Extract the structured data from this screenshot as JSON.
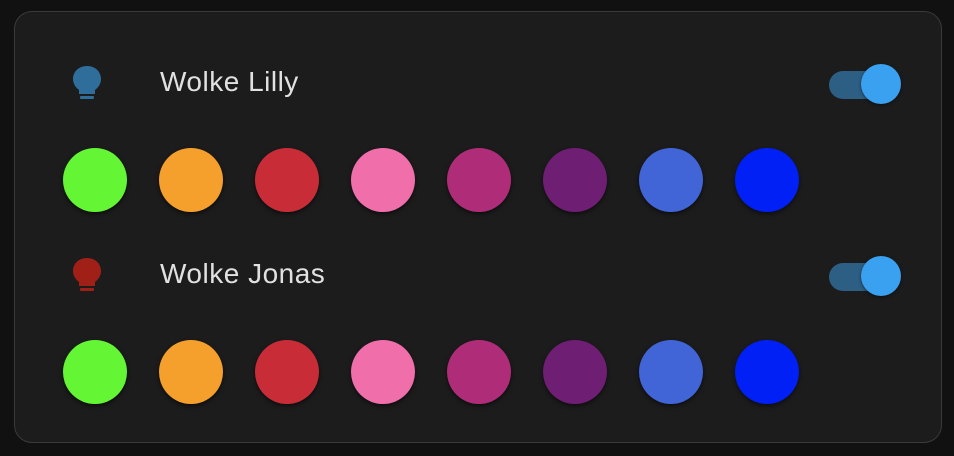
{
  "lights": [
    {
      "name": "Wolke Lilly",
      "icon": "lightbulb-icon",
      "icon_color": "#2f6e9a",
      "state": "on",
      "toggle_track_color": "#2d5f85",
      "toggle_knob_color": "#3aa0f0"
    },
    {
      "name": "Wolke Jonas",
      "icon": "lightbulb-icon",
      "icon_color": "#a02018",
      "state": "on",
      "toggle_track_color": "#2d5f85",
      "toggle_knob_color": "#3aa0f0"
    }
  ],
  "swatch_colors": [
    "#64f534",
    "#f5a02d",
    "#c82d37",
    "#f06eaa",
    "#af2d78",
    "#6e1e73",
    "#4164d7",
    "#0020f5"
  ]
}
